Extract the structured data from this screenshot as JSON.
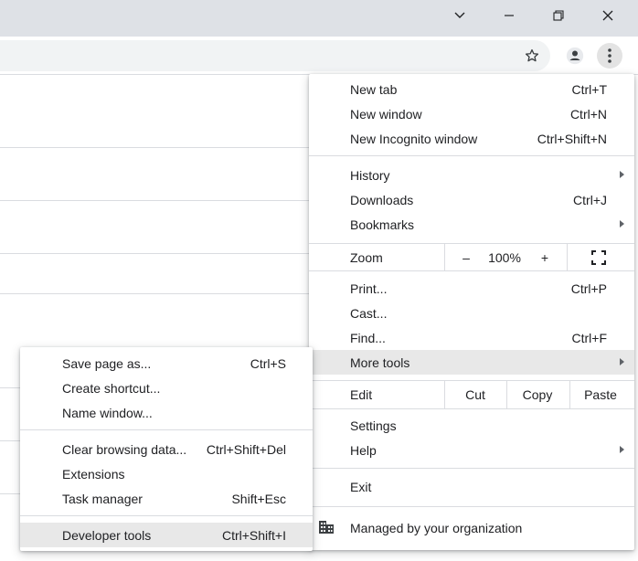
{
  "main_menu": {
    "new_tab": {
      "label": "New tab",
      "shortcut": "Ctrl+T"
    },
    "new_window": {
      "label": "New window",
      "shortcut": "Ctrl+N"
    },
    "new_incognito": {
      "label": "New Incognito window",
      "shortcut": "Ctrl+Shift+N"
    },
    "history": {
      "label": "History"
    },
    "downloads": {
      "label": "Downloads",
      "shortcut": "Ctrl+J"
    },
    "bookmarks": {
      "label": "Bookmarks"
    },
    "zoom": {
      "label": "Zoom",
      "minus": "–",
      "level": "100%",
      "plus": "+"
    },
    "print": {
      "label": "Print...",
      "shortcut": "Ctrl+P"
    },
    "cast": {
      "label": "Cast..."
    },
    "find": {
      "label": "Find...",
      "shortcut": "Ctrl+F"
    },
    "more_tools": {
      "label": "More tools"
    },
    "edit": {
      "label": "Edit",
      "cut": "Cut",
      "copy": "Copy",
      "paste": "Paste"
    },
    "settings": {
      "label": "Settings"
    },
    "help": {
      "label": "Help"
    },
    "exit": {
      "label": "Exit"
    },
    "managed": {
      "label": "Managed by your organization"
    }
  },
  "more_tools_menu": {
    "save_page": {
      "label": "Save page as...",
      "shortcut": "Ctrl+S"
    },
    "create_shortcut": {
      "label": "Create shortcut..."
    },
    "name_window": {
      "label": "Name window..."
    },
    "clear_data": {
      "label": "Clear browsing data...",
      "shortcut": "Ctrl+Shift+Del"
    },
    "extensions": {
      "label": "Extensions"
    },
    "task_manager": {
      "label": "Task manager",
      "shortcut": "Shift+Esc"
    },
    "developer_tools": {
      "label": "Developer tools",
      "shortcut": "Ctrl+Shift+I"
    }
  },
  "toolbar": {
    "icons": [
      "star-icon",
      "profile-icon",
      "kebab-menu-icon"
    ]
  },
  "window_controls": [
    "chevron-down-icon",
    "minimize-icon",
    "restore-icon",
    "close-icon"
  ],
  "colors": {
    "titlebar": "#dee1e6",
    "highlight": "#e8e8e8",
    "separator": "#dadce0",
    "text": "#202124"
  }
}
